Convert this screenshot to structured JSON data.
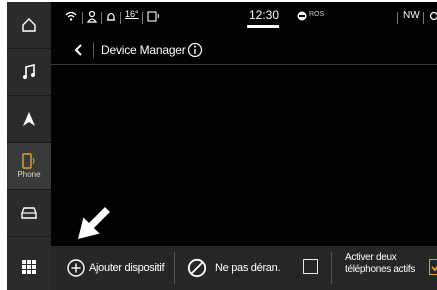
{
  "status_bar": {
    "temperature": "16°",
    "time": "12:30",
    "radio": "ROS",
    "compass": "NW"
  },
  "rail": {
    "items": [
      {
        "name": "home",
        "icon": "home-icon"
      },
      {
        "name": "media",
        "icon": "music-note-icon"
      },
      {
        "name": "navigation",
        "icon": "navigation-arrow-icon"
      },
      {
        "name": "phone",
        "icon": "phone-icon",
        "label": "Phone",
        "active": true
      },
      {
        "name": "vehicle",
        "icon": "car-icon"
      },
      {
        "name": "apps",
        "icon": "grid-icon"
      }
    ]
  },
  "header": {
    "title": "Device Manager"
  },
  "bottom_bar": {
    "add_device": "Ajouter dispositif",
    "do_not_disturb": "Ne pas déran.",
    "dual_phones_line1": "Activer deux",
    "dual_phones_line2": "téléphones actifs"
  },
  "colors": {
    "accent": "#e8a020",
    "background": "#000000",
    "rail": "#2b2b2b",
    "bottom_bar": "#262626"
  }
}
